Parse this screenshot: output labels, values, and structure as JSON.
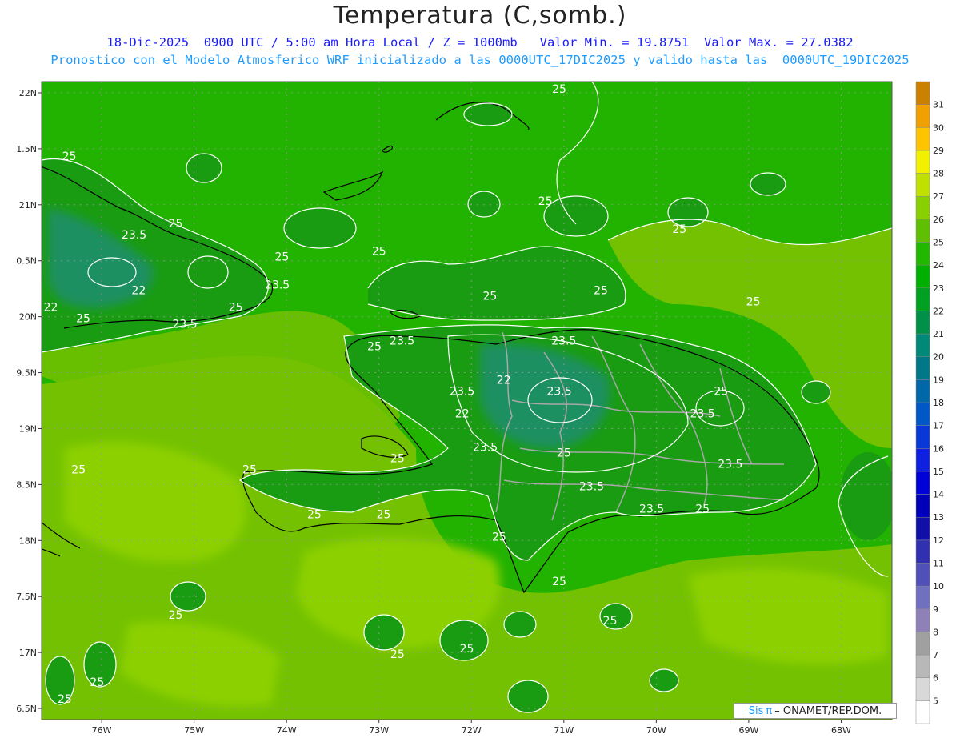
{
  "header": {
    "title": "Temperatura (C,somb.)",
    "subtitle_line1": "18-Dic-2025  0900 UTC / 5:00 am Hora Local / Z = 1000mb   Valor Min. = 19.8751  Valor Max. = 27.0382",
    "subtitle_line2": "Pronostico con el Modelo Atmosferico WRF inicializado a las 0000UTC_17DIC2025 y valido hasta las  0000UTC_19DIC2025"
  },
  "map": {
    "lon_range": [
      -76.65,
      -67.45
    ],
    "lat_range": [
      16.4,
      22.1
    ],
    "lat_ticks": [
      {
        "value": 22,
        "label": "22N"
      },
      {
        "value": 21.5,
        "label": "1.5N"
      },
      {
        "value": 21,
        "label": "21N"
      },
      {
        "value": 20.5,
        "label": "0.5N"
      },
      {
        "value": 20,
        "label": "20N"
      },
      {
        "value": 19.5,
        "label": "9.5N"
      },
      {
        "value": 19,
        "label": "19N"
      },
      {
        "value": 18.5,
        "label": "8.5N"
      },
      {
        "value": 18,
        "label": "18N"
      },
      {
        "value": 17.5,
        "label": "7.5N"
      },
      {
        "value": 17,
        "label": "17N"
      },
      {
        "value": 16.5,
        "label": "6.5N"
      }
    ],
    "lon_ticks": [
      {
        "value": -76,
        "label": "76W"
      },
      {
        "value": -75,
        "label": "75W"
      },
      {
        "value": -74,
        "label": "74W"
      },
      {
        "value": -73,
        "label": "73W"
      },
      {
        "value": -72,
        "label": "72W"
      },
      {
        "value": -71,
        "label": "71W"
      },
      {
        "value": -70,
        "label": "70W"
      },
      {
        "value": -69,
        "label": "69W"
      },
      {
        "value": -68,
        "label": "68W"
      }
    ],
    "contour_labels": [
      {
        "text": "25",
        "lon": -71.05,
        "lat": 22.0
      },
      {
        "text": "25",
        "lon": -76.35,
        "lat": 21.4
      },
      {
        "text": "25",
        "lon": -71.2,
        "lat": 21.0
      },
      {
        "text": "25",
        "lon": -75.2,
        "lat": 20.8
      },
      {
        "text": "23.5",
        "lon": -75.65,
        "lat": 20.7
      },
      {
        "text": "25",
        "lon": -74.05,
        "lat": 20.5
      },
      {
        "text": "25",
        "lon": -73.0,
        "lat": 20.55
      },
      {
        "text": "25",
        "lon": -69.75,
        "lat": 20.75
      },
      {
        "text": "23.5",
        "lon": -74.1,
        "lat": 20.25
      },
      {
        "text": "22",
        "lon": -75.6,
        "lat": 20.2
      },
      {
        "text": "22",
        "lon": -76.55,
        "lat": 20.05
      },
      {
        "text": "25",
        "lon": -76.2,
        "lat": 19.95
      },
      {
        "text": "23.5",
        "lon": -75.1,
        "lat": 19.9
      },
      {
        "text": "25",
        "lon": -74.55,
        "lat": 20.05
      },
      {
        "text": "25",
        "lon": -71.8,
        "lat": 20.15
      },
      {
        "text": "25",
        "lon": -70.6,
        "lat": 20.2
      },
      {
        "text": "25",
        "lon": -68.95,
        "lat": 20.1
      },
      {
        "text": "25",
        "lon": -73.05,
        "lat": 19.7
      },
      {
        "text": "23.5",
        "lon": -72.75,
        "lat": 19.75
      },
      {
        "text": "23.5",
        "lon": -71.0,
        "lat": 19.75
      },
      {
        "text": "22",
        "lon": -71.65,
        "lat": 19.4
      },
      {
        "text": "23.5",
        "lon": -72.1,
        "lat": 19.3
      },
      {
        "text": "23.5",
        "lon": -71.05,
        "lat": 19.3
      },
      {
        "text": "25",
        "lon": -69.3,
        "lat": 19.3
      },
      {
        "text": "22",
        "lon": -72.1,
        "lat": 19.1
      },
      {
        "text": "23.5",
        "lon": -69.5,
        "lat": 19.1
      },
      {
        "text": "23.5",
        "lon": -71.85,
        "lat": 18.8
      },
      {
        "text": "25",
        "lon": -71.0,
        "lat": 18.75
      },
      {
        "text": "25",
        "lon": -72.8,
        "lat": 18.7
      },
      {
        "text": "23.5",
        "lon": -69.2,
        "lat": 18.65
      },
      {
        "text": "25",
        "lon": -76.25,
        "lat": 18.6
      },
      {
        "text": "25",
        "lon": -74.4,
        "lat": 18.6
      },
      {
        "text": "23.5",
        "lon": -70.7,
        "lat": 18.45
      },
      {
        "text": "23.5",
        "lon": -70.05,
        "lat": 18.25
      },
      {
        "text": "25",
        "lon": -69.5,
        "lat": 18.25
      },
      {
        "text": "25",
        "lon": -73.7,
        "lat": 18.2
      },
      {
        "text": "25",
        "lon": -72.95,
        "lat": 18.2
      },
      {
        "text": "25",
        "lon": -71.7,
        "lat": 18.0
      },
      {
        "text": "25",
        "lon": -71.05,
        "lat": 17.6
      },
      {
        "text": "25",
        "lon": -75.2,
        "lat": 17.3
      },
      {
        "text": "25",
        "lon": -70.5,
        "lat": 17.25
      },
      {
        "text": "25",
        "lon": -72.8,
        "lat": 16.95
      },
      {
        "text": "25",
        "lon": -72.05,
        "lat": 17.0
      },
      {
        "text": "25",
        "lon": -76.05,
        "lat": 16.7
      },
      {
        "text": "25",
        "lon": -76.4,
        "lat": 16.55
      }
    ]
  },
  "colorbar": {
    "levels": [
      5,
      6,
      7,
      8,
      9,
      10,
      11,
      12,
      13,
      14,
      15,
      16,
      17,
      18,
      19,
      20,
      21,
      22,
      23,
      24,
      25,
      26,
      27,
      28,
      29,
      30,
      31
    ],
    "colors": [
      "#ffffff",
      "#d8d8d8",
      "#b8b8b8",
      "#a0a0a0",
      "#9080b8",
      "#7070c0",
      "#5050b8",
      "#3030b0",
      "#1010a8",
      "#0000b8",
      "#0000d8",
      "#1020e0",
      "#0838d8",
      "#0058c8",
      "#0068a8",
      "#007888",
      "#008878",
      "#009048",
      "#00a020",
      "#00b000",
      "#22b800",
      "#5ec000",
      "#88d000",
      "#c0e000",
      "#f0f000",
      "#ffc400",
      "#f0a000",
      "#cc8000"
    ]
  },
  "credit": {
    "sis": "Sis",
    "pi": "π",
    "rest": "– ONAMET/REP.DOM."
  },
  "colors": {
    "bg_green": "#22b200",
    "dark_green": "#1a9c12",
    "mid_green": "#3db500",
    "yellow_green": "#73c100",
    "light_green": "#8cd000",
    "teal": "#1a9060"
  }
}
